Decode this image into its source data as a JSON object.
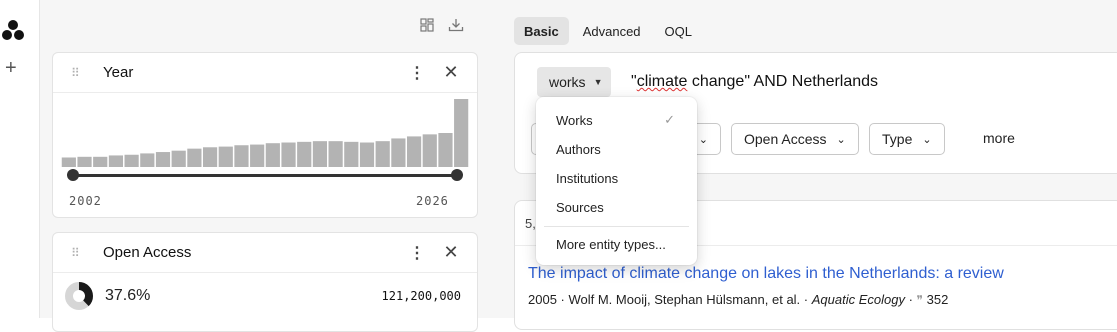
{
  "left_panel": {
    "year_filter": {
      "title": "Year",
      "range_start": "2002",
      "range_end": "2026",
      "histogram": [
        0.14,
        0.15,
        0.15,
        0.17,
        0.18,
        0.2,
        0.22,
        0.24,
        0.27,
        0.29,
        0.3,
        0.32,
        0.33,
        0.35,
        0.36,
        0.37,
        0.38,
        0.38,
        0.37,
        0.36,
        0.38,
        0.42,
        0.45,
        0.48,
        0.5,
        1.0
      ]
    },
    "open_access_filter": {
      "title": "Open Access",
      "percent": "37.6%",
      "percent_value": 37.6,
      "count": "121,200,000"
    }
  },
  "right_panel": {
    "tabs": [
      "Basic",
      "Advanced",
      "OQL"
    ],
    "entity_button": "works",
    "query": {
      "prefix": "\"",
      "misspelled": "climate",
      "rest": " change\" AND Netherlands"
    },
    "filters": {
      "open_access": "Open Access",
      "type": "Type",
      "more": "more"
    },
    "results": {
      "count_prefix": "5,",
      "first_title": "The impact of climate change on lakes in the Netherlands: a review",
      "first_meta_prefix": "2005 · Wolf M. Mooij, Stephan Hülsmann, et al. · ",
      "first_venue": "Aquatic Ecology",
      "first_meta_sep": " · ",
      "first_citations": "352"
    }
  },
  "entity_dropdown": {
    "items": [
      "Works",
      "Authors",
      "Institutions",
      "Sources"
    ],
    "more_label": "More entity types...",
    "selected": "Works"
  },
  "colors": {
    "accent_link": "#2f5fd0",
    "histogram_bar": "#b3b3b3"
  }
}
